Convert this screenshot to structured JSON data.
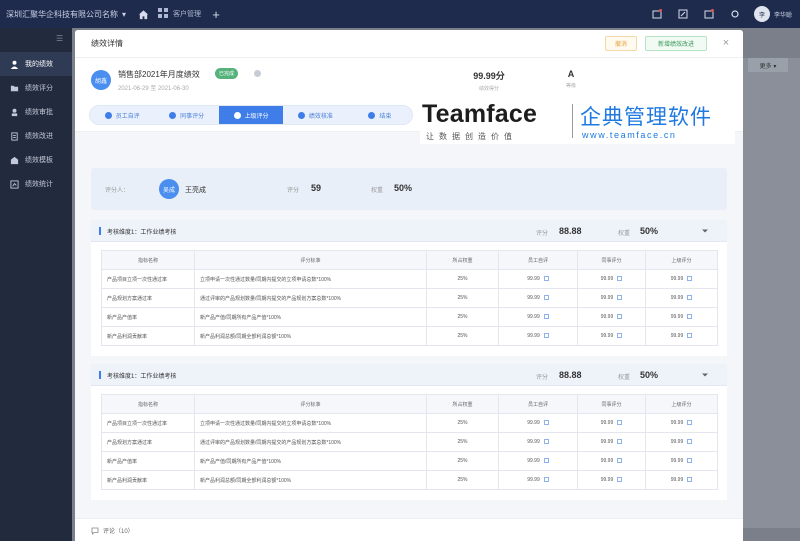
{
  "topbar": {
    "company": "深圳汇聚华企科技有限公司名称",
    "app_tab": "客户管理",
    "user_initial": "李",
    "user_name": "李华聪"
  },
  "sidebar": {
    "items": [
      {
        "label": "我的绩效",
        "icon": "user-icon"
      },
      {
        "label": "绩效评分",
        "icon": "folder-icon"
      },
      {
        "label": "绩效审批",
        "icon": "person-icon"
      },
      {
        "label": "绩效改进",
        "icon": "doc-icon"
      },
      {
        "label": "绩效模板",
        "icon": "template-icon"
      },
      {
        "label": "绩效统计",
        "icon": "chart-icon"
      }
    ]
  },
  "background": {
    "more_label": "更多 ▾"
  },
  "modal": {
    "title": "绩效详情",
    "warn_button": "撤消",
    "ok_button": "新增绩效改进",
    "avatar_text": "胡鑫",
    "plan_name": "销售部2021年月度绩效",
    "status_badge": "已完成",
    "dates": "2021-06-29 至 2021-06-30",
    "total_score": "99.99分",
    "total_score_label": "绩效得分",
    "grade": "A",
    "grade_label": "等级"
  },
  "steps": [
    {
      "label": "员工自评",
      "current": false
    },
    {
      "label": "同事评分",
      "current": false
    },
    {
      "label": "上级评分",
      "current": true
    },
    {
      "label": "绩效核准",
      "current": false
    },
    {
      "label": "结束",
      "current": false
    }
  ],
  "watermark": {
    "brand_en": "Teamface",
    "slogan": "让数据创造价值",
    "brand_cn": "企典管理软件",
    "url": "www.teamface.cn"
  },
  "evaluator": {
    "label": "评分人：",
    "avatar_text": "吴成",
    "name": "王亮成",
    "score_label": "评分",
    "score": "59",
    "weight_label": "权重",
    "weight": "50%"
  },
  "dimensions": [
    {
      "title": "考核维度1：工作业绩考核",
      "score_label": "评分",
      "score": "88.88",
      "weight_label": "权重",
      "weight": "50%",
      "headers": [
        "指标名称",
        "评分标准",
        "所占权重",
        "员工自评",
        "同事评分",
        "上级评分"
      ],
      "rows": [
        [
          "产品项目立项一次性通过率",
          "立项申请一次性通过数量/同期内提交的立项申请总数*100%",
          "25%",
          "99.99",
          "99.99",
          "99.99"
        ],
        [
          "产品规划方案通过率",
          "通过评审的产品规划数量/同期内提交的产品规划方案总数*100%",
          "25%",
          "99.99",
          "99.99",
          "99.99"
        ],
        [
          "新产品产值率",
          "新产品产值/同期所有产品产值*100%",
          "25%",
          "99.99",
          "99.99",
          "99.99"
        ],
        [
          "新产品利润贡献率",
          "新产品利润总额/同期全部利润总额*100%",
          "25%",
          "99.99",
          "99.99",
          "99.99"
        ]
      ]
    },
    {
      "title": "考核维度1：工作业绩考核",
      "score_label": "评分",
      "score": "88.88",
      "weight_label": "权重",
      "weight": "50%",
      "headers": [
        "指标名称",
        "评分标准",
        "所占权重",
        "员工自评",
        "同事评分",
        "上级评分"
      ],
      "rows": [
        [
          "产品项目立项一次性通过率",
          "立项申请一次性通过数量/同期内提交的立项申请总数*100%",
          "25%",
          "99.99",
          "99.99",
          "99.99"
        ],
        [
          "产品规划方案通过率",
          "通过评审的产品规划数量/同期内提交的产品规划方案总数*100%",
          "25%",
          "99.99",
          "99.99",
          "99.99"
        ],
        [
          "新产品产值率",
          "新产品产值/同期所有产品产值*100%",
          "25%",
          "99.99",
          "99.99",
          "99.99"
        ],
        [
          "新产品利润贡献率",
          "新产品利润总额/同期全部利润总额*100%",
          "25%",
          "99.99",
          "99.99",
          "99.99"
        ]
      ]
    }
  ],
  "footer": {
    "comment_label": "评论（10）"
  },
  "colors": {
    "accent": "#3f7ee8",
    "topbar": "#1f2b4d",
    "sidebar": "#222a3d",
    "success": "#55b27a",
    "brand_blue": "#1e79e0"
  }
}
